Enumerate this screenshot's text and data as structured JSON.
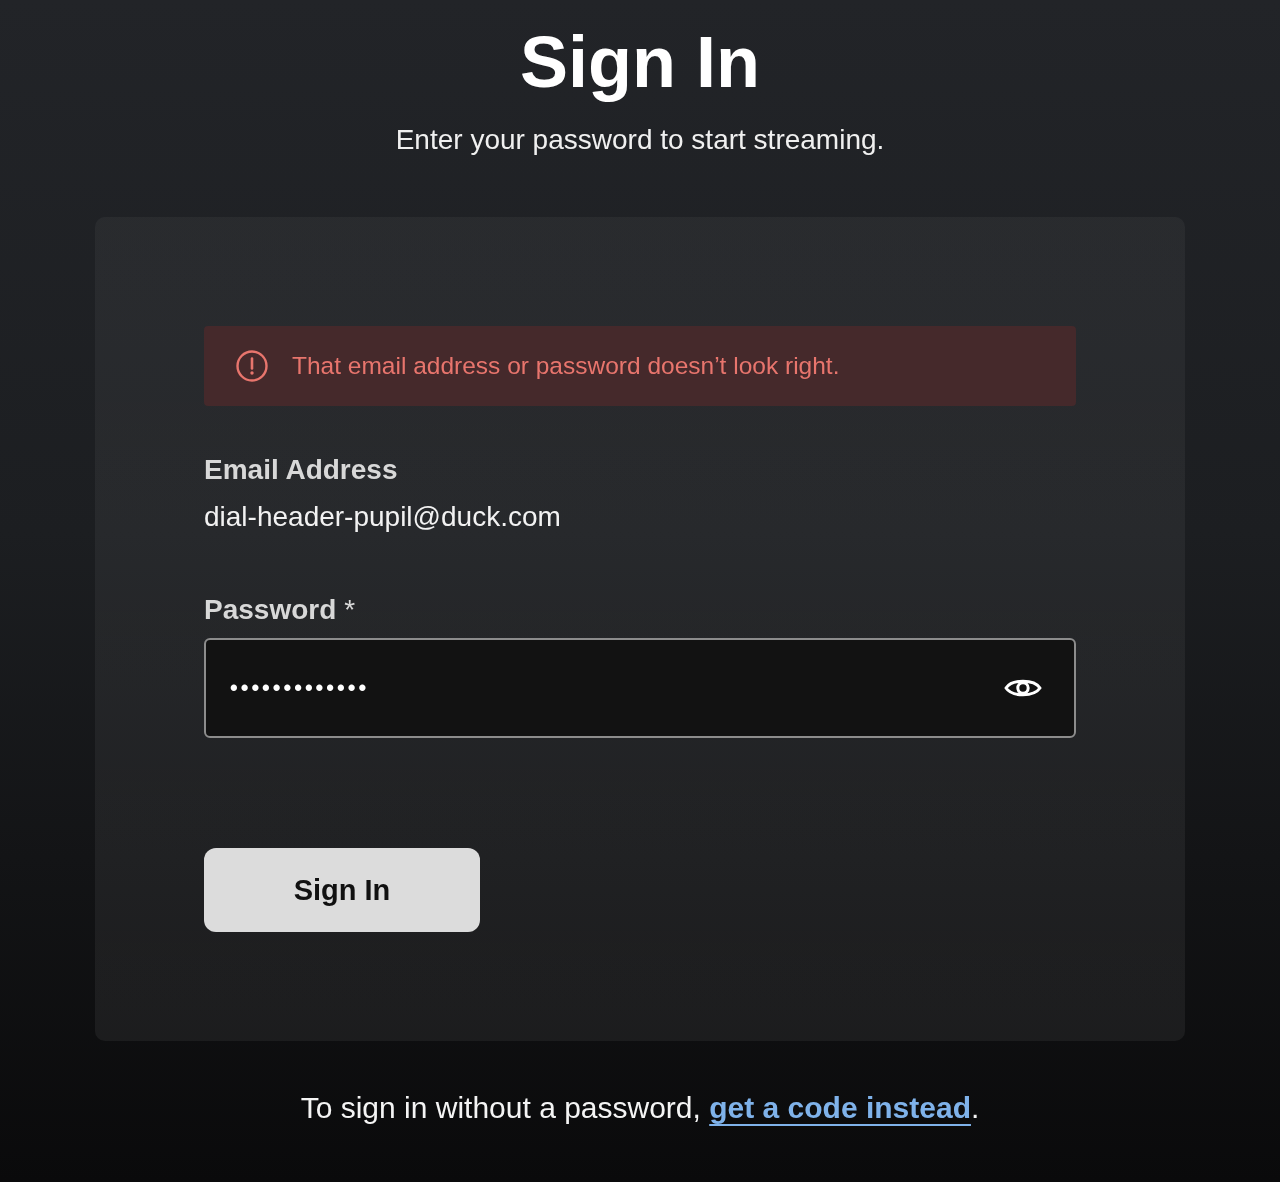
{
  "title": "Sign In",
  "subtitle": "Enter your password to start streaming.",
  "alert": {
    "kind": "error",
    "message": "That email address or password doesn’t look right."
  },
  "fields": [
    {
      "kind": "static",
      "label": "Email Address",
      "value": "dial-header-pupil@duck.com"
    },
    {
      "kind": "password",
      "label": "Password",
      "required_mark": "*",
      "value": "•••••••••••••"
    }
  ],
  "button": {
    "label": "Sign In"
  },
  "footer": {
    "text": "To sign in without a password, ",
    "link": "get a code instead",
    "end": "."
  }
}
